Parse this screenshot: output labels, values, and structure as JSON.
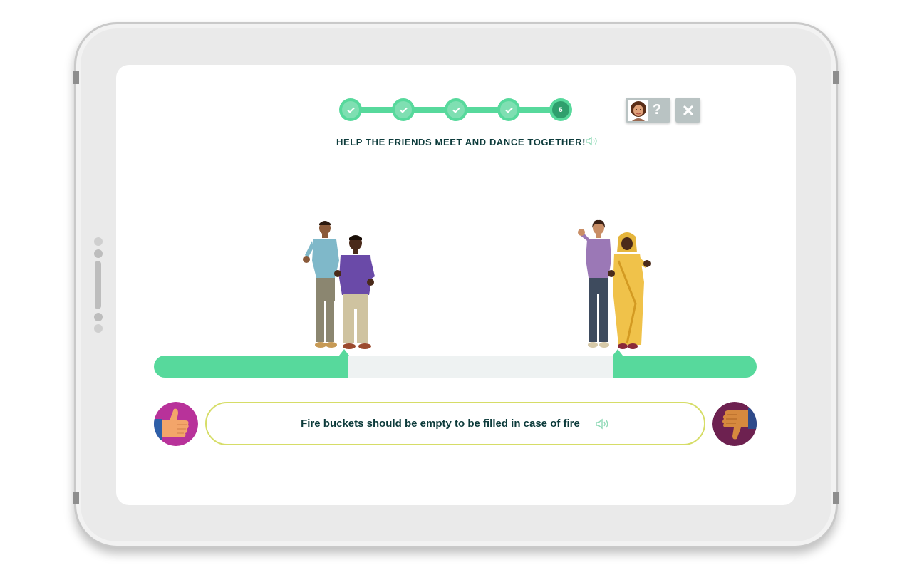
{
  "progress": {
    "steps": [
      {
        "state": "done",
        "icon": "check-icon"
      },
      {
        "state": "done",
        "icon": "check-icon"
      },
      {
        "state": "done",
        "icon": "check-icon"
      },
      {
        "state": "done",
        "icon": "check-icon"
      },
      {
        "state": "current",
        "label": "5"
      }
    ]
  },
  "toolbar": {
    "help_label": "?",
    "close_icon": "close-icon",
    "avatar_icon": "avatar-icon"
  },
  "instruction": {
    "text": "HELP THE FRIENDS MEET AND DANCE TOGETHER!",
    "speaker_icon": "speaker-icon"
  },
  "statement": {
    "text": "Fire buckets should be empty to be filled in case of fire",
    "speaker_icon": "speaker-icon"
  },
  "answers": {
    "agree_icon": "thumbs-up-icon",
    "disagree_icon": "thumbs-down-icon"
  },
  "colors": {
    "accent_green": "#57d99c",
    "dark_green": "#2f9f6d",
    "text_dark": "#0d3b3b",
    "statement_border": "#d6dd67",
    "agree_bg": "#b8329a",
    "disagree_bg": "#6d2150",
    "button_grey": "#b9c3c3"
  }
}
